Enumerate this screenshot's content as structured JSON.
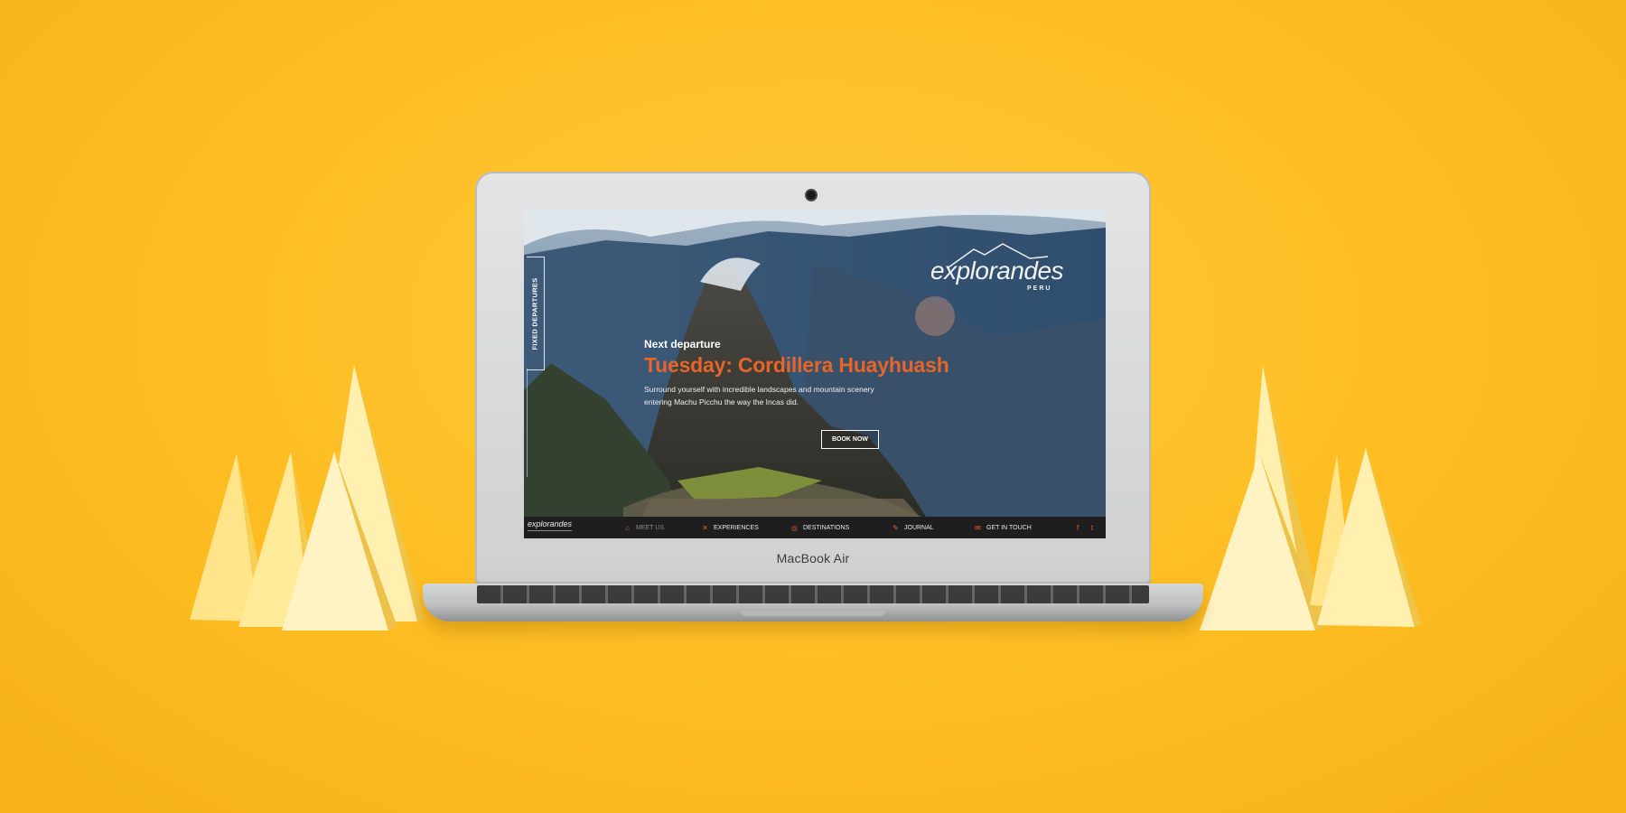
{
  "device": {
    "model_label": "MacBook Air"
  },
  "site": {
    "side_tab": "FIXED DEPARTURES",
    "logo": {
      "name": "explorandes",
      "sub": "PERU"
    },
    "hero": {
      "kicker": "Next departure",
      "title": "Tuesday: Cordillera Huayhuash",
      "description": "Surround yourself with incredible landscapes and mountain scenery entering Machu Picchu the way the Incas did.",
      "cta": "BOOK NOW"
    },
    "nav": {
      "logo_text": "explorandes",
      "items": [
        {
          "label": "MEET US",
          "icon": "house-icon",
          "glyph": "⌂"
        },
        {
          "label": "EXPERIENCES",
          "icon": "experiences-icon",
          "glyph": "✕"
        },
        {
          "label": "DESTINATIONS",
          "icon": "compass-icon",
          "glyph": "◎"
        },
        {
          "label": "JOURNAL",
          "icon": "pencil-icon",
          "glyph": "✎"
        },
        {
          "label": "GET IN TOUCH",
          "icon": "mail-icon",
          "glyph": "✉"
        }
      ],
      "social": [
        {
          "icon": "facebook-icon",
          "glyph": "f"
        },
        {
          "icon": "twitter-icon",
          "glyph": "t"
        }
      ]
    }
  },
  "colors": {
    "background": "#fdbd22",
    "accent": "#e8652a",
    "nav_bg": "#1e1e1e"
  }
}
